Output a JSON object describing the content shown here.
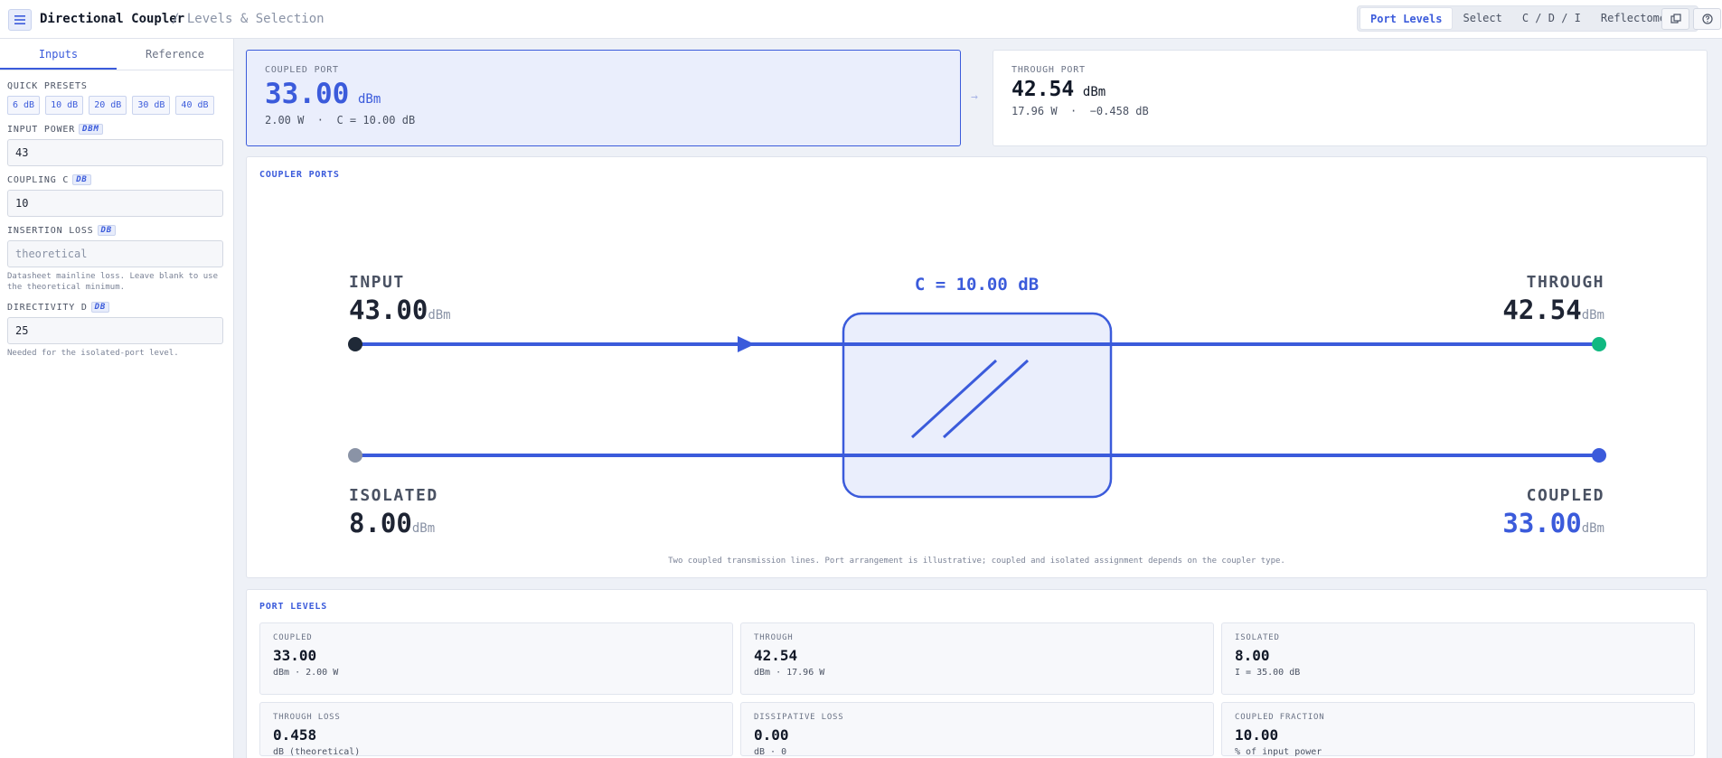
{
  "app": {
    "title": "Directional Coupler",
    "crumb": "/ Levels & Selection"
  },
  "modes": [
    {
      "label": "Port Levels",
      "active": true
    },
    {
      "label": "Select",
      "active": false
    },
    {
      "label": "C / D / I",
      "active": false
    },
    {
      "label": "Reflectometer",
      "active": false
    }
  ],
  "sidebar": {
    "tabs": [
      {
        "label": "Inputs",
        "active": true
      },
      {
        "label": "Reference",
        "active": false
      }
    ],
    "quick_presets_label": "Quick Presets",
    "presets": [
      "6 dB",
      "10 dB",
      "20 dB",
      "30 dB",
      "40 dB"
    ],
    "input_power": {
      "label": "Input Power",
      "unit": "DBM",
      "value": "43"
    },
    "coupling": {
      "label": "Coupling C",
      "unit": "DB",
      "value": "10"
    },
    "insertion_loss": {
      "label": "Insertion Loss",
      "unit": "DB",
      "placeholder": "theoretical",
      "hint": "Datasheet mainline loss. Leave blank to use the theoretical minimum."
    },
    "directivity": {
      "label": "Directivity D",
      "unit": "DB",
      "value": "25",
      "hint": "Needed for the isolated-port level."
    }
  },
  "coupled_card": {
    "label": "Coupled Port",
    "value": "33.00",
    "unit": "dBm",
    "sub": "2.00 W  ·  C = 10.00 dB"
  },
  "arrow": "→",
  "through_card": {
    "label": "Through Port",
    "value": "42.54",
    "unit": "dBm",
    "sub": "17.96 W  ·  −0.458 dB"
  },
  "diagram": {
    "label": "Coupler Ports",
    "coupling_label": "C = 10.00 dB",
    "ports": {
      "input": {
        "name": "INPUT",
        "value": "43.00",
        "unit": "dBm"
      },
      "through": {
        "name": "THROUGH",
        "value": "42.54",
        "unit": "dBm"
      },
      "isolated": {
        "name": "ISOLATED",
        "value": "8.00",
        "unit": "dBm"
      },
      "coupled": {
        "name": "COUPLED",
        "value": "33.00",
        "unit": "dBm"
      }
    },
    "caption": "Two coupled transmission lines. Port arrangement is illustrative; coupled and isolated assignment depends on the coupler type."
  },
  "port_levels": {
    "label": "Port Levels",
    "tiles": [
      {
        "label": "Coupled",
        "value": "33.00",
        "sub": "dBm · 2.00 W"
      },
      {
        "label": "Through",
        "value": "42.54",
        "sub": "dBm · 17.96 W"
      },
      {
        "label": "Isolated",
        "value": "8.00",
        "sub": "I = 35.00 dB"
      },
      {
        "label": "Through Loss",
        "value": "0.458",
        "sub": "dB (theoretical)"
      },
      {
        "label": "Dissipative Loss",
        "value": "0.00",
        "sub": "dB · 0"
      },
      {
        "label": "Coupled Fraction",
        "value": "10.00",
        "sub": "% of input power"
      }
    ]
  },
  "colors": {
    "accent": "#3b5bdb",
    "through_dot": "#10b981",
    "input_dot": "#1f2937",
    "isolated_dot": "#8a93a6"
  }
}
